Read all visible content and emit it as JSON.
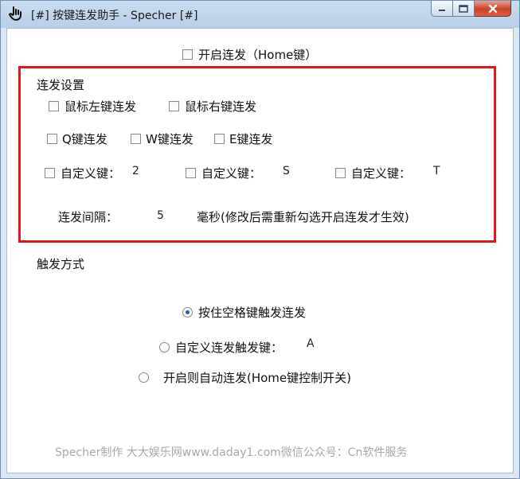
{
  "window": {
    "title": "[#] 按键连发助手 - Specher [#]"
  },
  "master_toggle": {
    "label": "开启连发（Home键）",
    "checked": false
  },
  "settings": {
    "group_label": "连发设置",
    "mouse_left": "鼠标左键连发",
    "mouse_right": "鼠标右键连发",
    "key_q": "Q键连发",
    "key_w": "W键连发",
    "key_e": "E键连发",
    "custom_label": "自定义键：",
    "custom1_value": "2",
    "custom2_value": "S",
    "custom3_value": "T",
    "interval_label": "连发间隔：",
    "interval_value": "5",
    "interval_unit": "毫秒(修改后需重新勾选开启连发才生效)"
  },
  "trigger": {
    "group_label": "触发方式",
    "option_space": "按住空格键触发连发",
    "option_custom": "自定义连发触发键：",
    "custom_trigger_value": "A",
    "option_auto": "开启则自动连发(Home键控制开关)",
    "selected": "option_space"
  },
  "footer": "Specher制作 大大娱乐网www.daday1.com微信公众号：Cn软件服务"
}
